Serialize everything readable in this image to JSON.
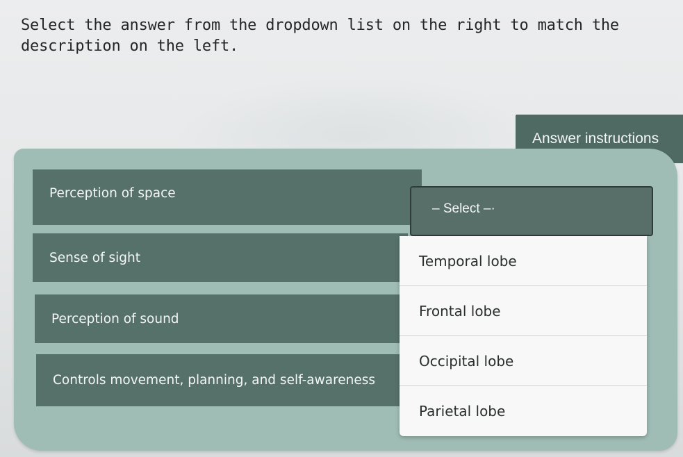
{
  "instruction": "Select the answer from the dropdown list on the right to match the description on the left.",
  "answer_instructions_label": "Answer instructions",
  "prompts": [
    "Perception of space",
    "Sense of sight",
    "Perception of sound",
    "Controls movement, planning, and self-awareness"
  ],
  "dropdown": {
    "selected": "– Select –·",
    "options": [
      "Temporal lobe",
      "Frontal lobe",
      "Occipital lobe",
      "Parietal lobe"
    ]
  },
  "colors": {
    "prompt_bg": "#56716a",
    "panel_bg": "#9fbcb5",
    "menu_bg": "#f7f8f7"
  }
}
